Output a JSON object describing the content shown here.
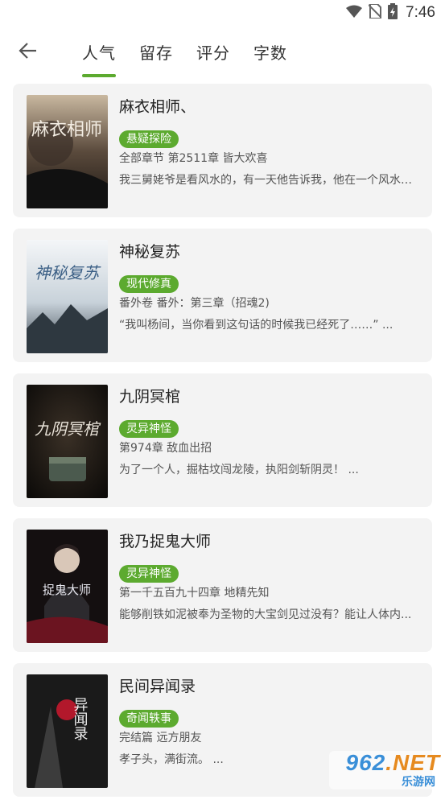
{
  "status_bar": {
    "time": "7:46",
    "icons": [
      "wifi-icon",
      "no-sim-icon",
      "battery-icon"
    ]
  },
  "nav": {
    "back_icon": "back-arrow-icon",
    "tabs": [
      {
        "label": "人气",
        "active": true
      },
      {
        "label": "留存",
        "active": false
      },
      {
        "label": "评分",
        "active": false
      },
      {
        "label": "字数",
        "active": false
      }
    ]
  },
  "books": [
    {
      "title": "麻衣相师、",
      "tag": "悬疑探险",
      "chapter": "全部章节 第2511章 皆大欢喜",
      "desc": "我三舅姥爷是看风水的，有一天他告诉我，他在一个风水宝地...",
      "cover_text": "麻衣相师"
    },
    {
      "title": "神秘复苏",
      "tag": "现代修真",
      "chapter": "番外卷 番外：第三章（招魂2)",
      "desc": "“我叫杨间，当你看到这句话的时候我已经死了……” ...",
      "cover_text": "神秘复苏"
    },
    {
      "title": "九阴冥棺",
      "tag": "灵异神怪",
      "chapter": "第974章 敌血出招",
      "desc": "为了一个人，掘枯坟闯龙陵，执阳剑斩阴灵！ ...",
      "cover_text": "九阴冥棺"
    },
    {
      "title": "我乃捉鬼大师",
      "tag": "灵异神怪",
      "chapter": "第一千五百九十四章 地精先知",
      "desc": "能够削铁如泥被奉为圣物的大宝剑见过没有？能让人体内...",
      "cover_text": "捉鬼大师"
    },
    {
      "title": "民间异闻录",
      "tag": "奇闻轶事",
      "chapter": "完结篇 远方朋友",
      "desc": "孝子头，满街流。 ...",
      "cover_text": "异闻录"
    }
  ],
  "watermark": {
    "logo_a": "962",
    "logo_b": ".NET",
    "sub": "乐游网"
  },
  "colors": {
    "accent": "#5caa2f",
    "card_bg": "#f3f3f3"
  }
}
